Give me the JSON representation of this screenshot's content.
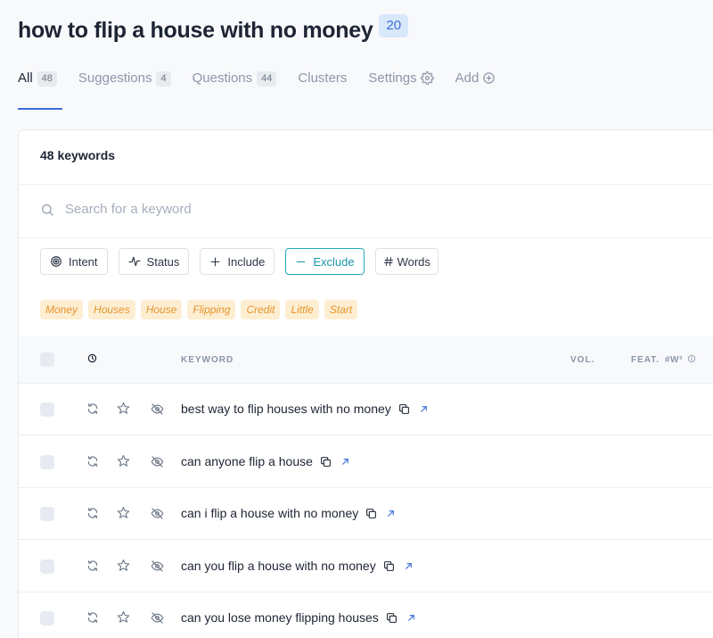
{
  "header": {
    "title": "how to flip a house with no money",
    "badge": "20"
  },
  "tabs": [
    {
      "label": "All",
      "count": "48"
    },
    {
      "label": "Suggestions",
      "count": "4"
    },
    {
      "label": "Questions",
      "count": "44"
    },
    {
      "label": "Clusters"
    },
    {
      "label": "Settings",
      "icon": "gear-icon"
    },
    {
      "label": "Add",
      "icon": "plus-circle-icon"
    }
  ],
  "card": {
    "keyword_count": "48 keywords"
  },
  "search": {
    "placeholder": "Search for a keyword"
  },
  "filters": [
    {
      "label": "Intent",
      "icon": "target-icon"
    },
    {
      "label": "Status",
      "icon": "pulse-icon"
    },
    {
      "label": "Include",
      "icon": "plus-icon"
    },
    {
      "label": "Exclude",
      "icon": "minus-icon"
    },
    {
      "label": "Words",
      "icon": "hash-icon"
    }
  ],
  "tags": [
    "Money",
    "Houses",
    "House",
    "Flipping",
    "Credit",
    "Little",
    "Start"
  ],
  "table": {
    "columns": {
      "keyword": "KEYWORD",
      "vol": "VOL.",
      "feat": "FEAT.",
      "words": "#W³"
    },
    "rows": [
      {
        "keyword": "best way to flip houses with no money"
      },
      {
        "keyword": "can anyone flip a house"
      },
      {
        "keyword": "can i flip a house with no money"
      },
      {
        "keyword": "can you flip a house with no money"
      },
      {
        "keyword": "can you lose money flipping houses"
      }
    ]
  },
  "colors": {
    "accent": "#3b6fd8",
    "exclude": "#2aa7b6",
    "tag_bg": "#fdeed2",
    "tag_text": "#e4952c"
  }
}
